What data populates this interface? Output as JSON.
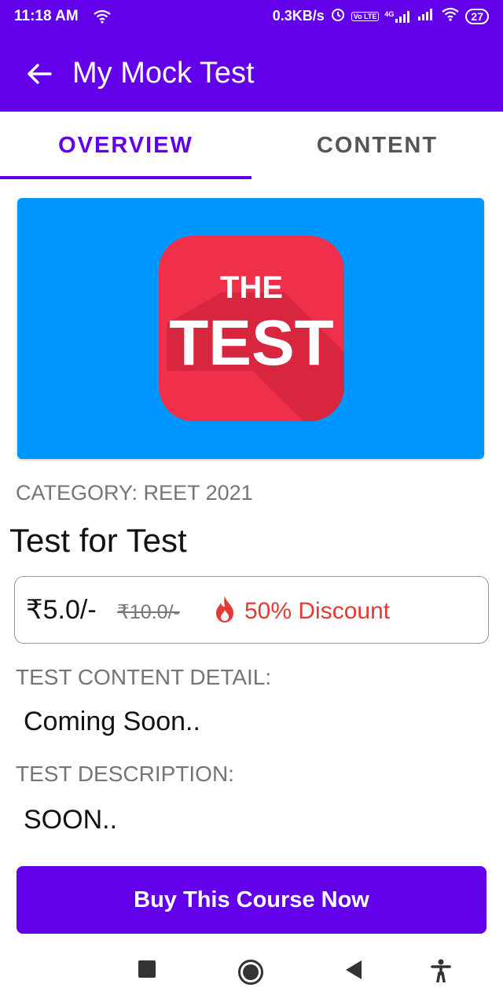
{
  "status_bar": {
    "time": "11:18 AM",
    "speed": "0.3KB/s",
    "network": "4G",
    "lte_tag": "Vo LTE",
    "battery": "27"
  },
  "app_bar": {
    "title": "My Mock Test"
  },
  "tabs": [
    {
      "label": "OVERVIEW",
      "selected": true
    },
    {
      "label": "CONTENT",
      "selected": false
    }
  ],
  "banner": {
    "line1": "THE",
    "line2": "TEST",
    "bg_color": "#0096ff",
    "icon_color": "#f0304a"
  },
  "course": {
    "category": "CATEGORY: REET 2021",
    "title": "Test for Test",
    "price": "₹5.0/-",
    "original_price": "₹10.0/-",
    "discount": "50% Discount"
  },
  "details": {
    "content_label": "TEST CONTENT DETAIL:",
    "content_value": "Coming Soon..",
    "description_label": "TEST DESCRIPTION:",
    "description_value": "SOON.."
  },
  "buy_button": {
    "label": "Buy This Course Now"
  },
  "colors": {
    "primary": "#6200ea",
    "discount": "#e53935"
  }
}
